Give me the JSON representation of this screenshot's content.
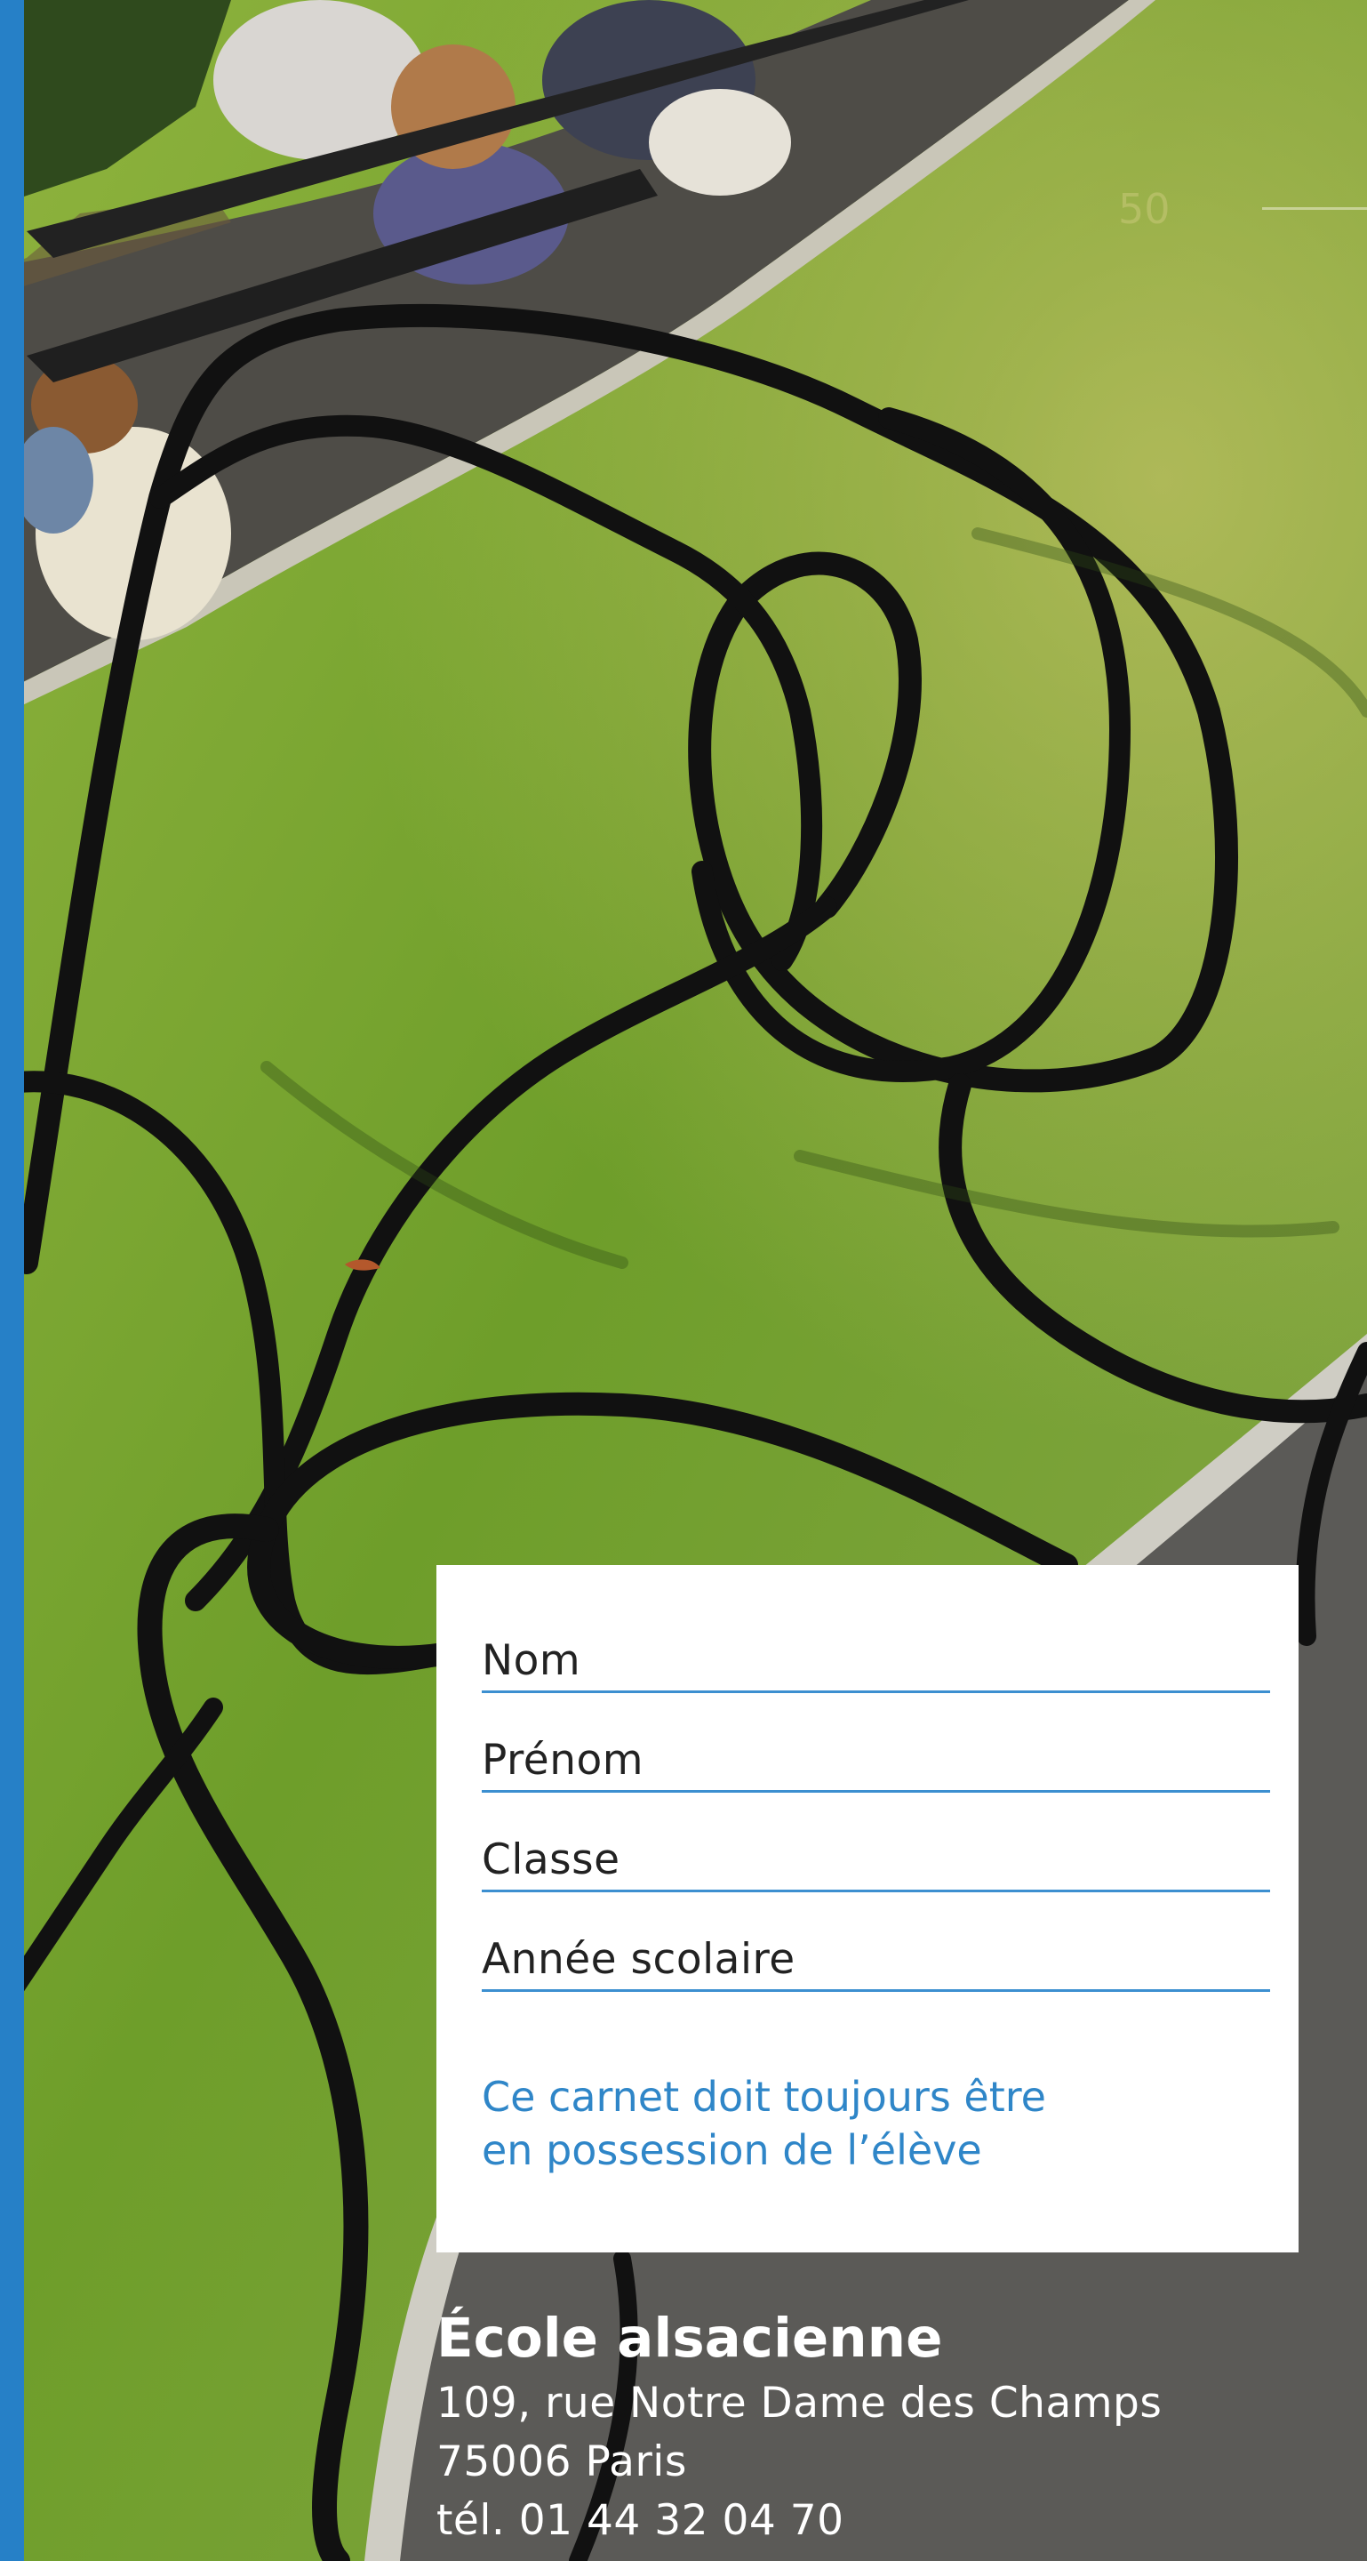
{
  "photo": {
    "description_icon": "park-sculpture-photo"
  },
  "page": {
    "number": "50"
  },
  "form": {
    "fields": [
      {
        "label": "Nom"
      },
      {
        "label": "Prénom"
      },
      {
        "label": "Classe"
      },
      {
        "label": "Année scolaire"
      }
    ],
    "note": [
      "Ce carnet doit toujours être",
      "en possession de l’élève"
    ]
  },
  "school": {
    "name": "École alsacienne",
    "street": "109, rue Notre Dame des Champs",
    "city": "75006 Paris",
    "phone": "tél. 01 44 32 04 70"
  },
  "colors": {
    "accent": "#2680c7",
    "field_rule": "#3c8fd0",
    "note_text": "#2f86c8",
    "card_bg": "#ffffff",
    "address_text": "#ffffff"
  }
}
